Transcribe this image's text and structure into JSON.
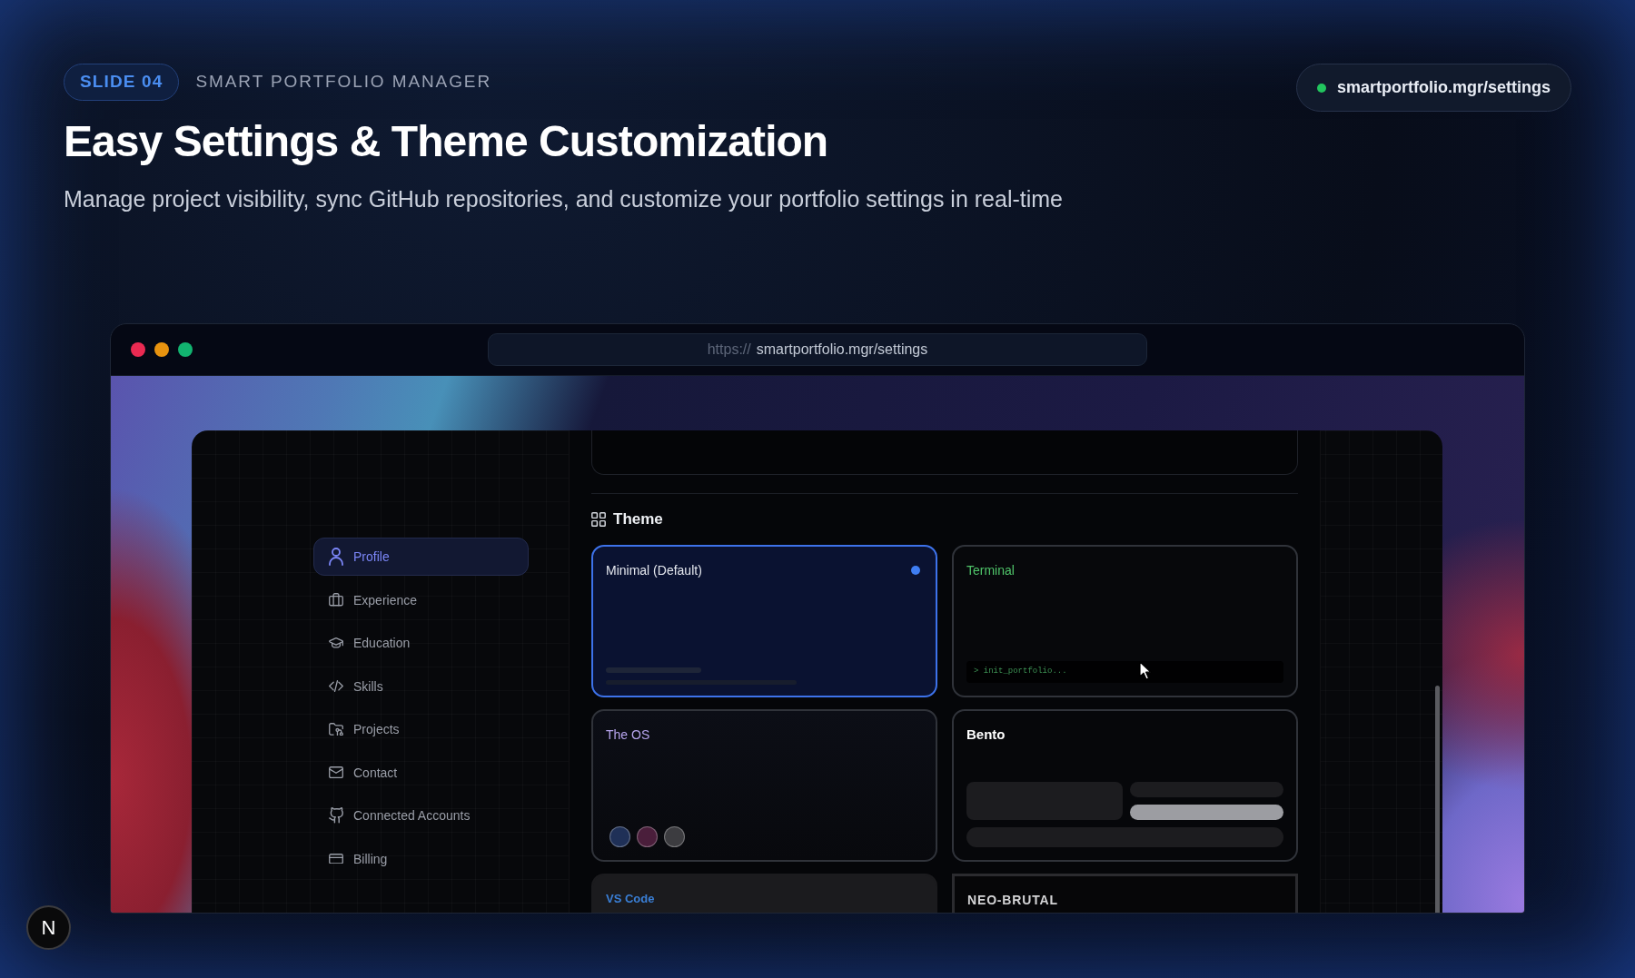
{
  "slide": {
    "badge": "SLIDE 04",
    "eyebrow": "SMART PORTFOLIO MANAGER",
    "title": "Easy Settings & Theme Customization",
    "subtitle": "Manage project visibility, sync GitHub repositories, and customize your portfolio settings in real-time"
  },
  "url_pill": {
    "text": "smartportfolio.mgr/settings"
  },
  "browser": {
    "address_bar": {
      "scheme": "https://",
      "url": "smartportfolio.mgr/settings"
    }
  },
  "sidebar": {
    "items": [
      {
        "label": "Profile",
        "selected": true
      },
      {
        "label": "Experience",
        "selected": false
      },
      {
        "label": "Education",
        "selected": false
      },
      {
        "label": "Skills",
        "selected": false
      },
      {
        "label": "Projects",
        "selected": false
      },
      {
        "label": "Contact",
        "selected": false
      },
      {
        "label": "Connected Accounts",
        "selected": false
      },
      {
        "label": "Billing",
        "selected": false
      }
    ]
  },
  "theme_section": {
    "heading": "Theme",
    "cards": [
      {
        "kind": "minimal",
        "title": "Minimal (Default)",
        "selected": true
      },
      {
        "kind": "terminal",
        "title": "Terminal",
        "selected": false,
        "command": "> init_portfolio..."
      },
      {
        "kind": "os",
        "title": "The OS",
        "selected": false,
        "swatches": [
          {
            "color": "#1f3057"
          },
          {
            "color": "#4a1e3b"
          },
          {
            "color": "#3c3c40"
          }
        ]
      },
      {
        "kind": "bento",
        "title": "Bento",
        "selected": false
      },
      {
        "kind": "vscode",
        "title": "VS Code",
        "selected": false
      },
      {
        "kind": "brutal",
        "title": "NEO-BRUTAL",
        "selected": false
      }
    ]
  },
  "dev_badge": {
    "label": "N"
  }
}
